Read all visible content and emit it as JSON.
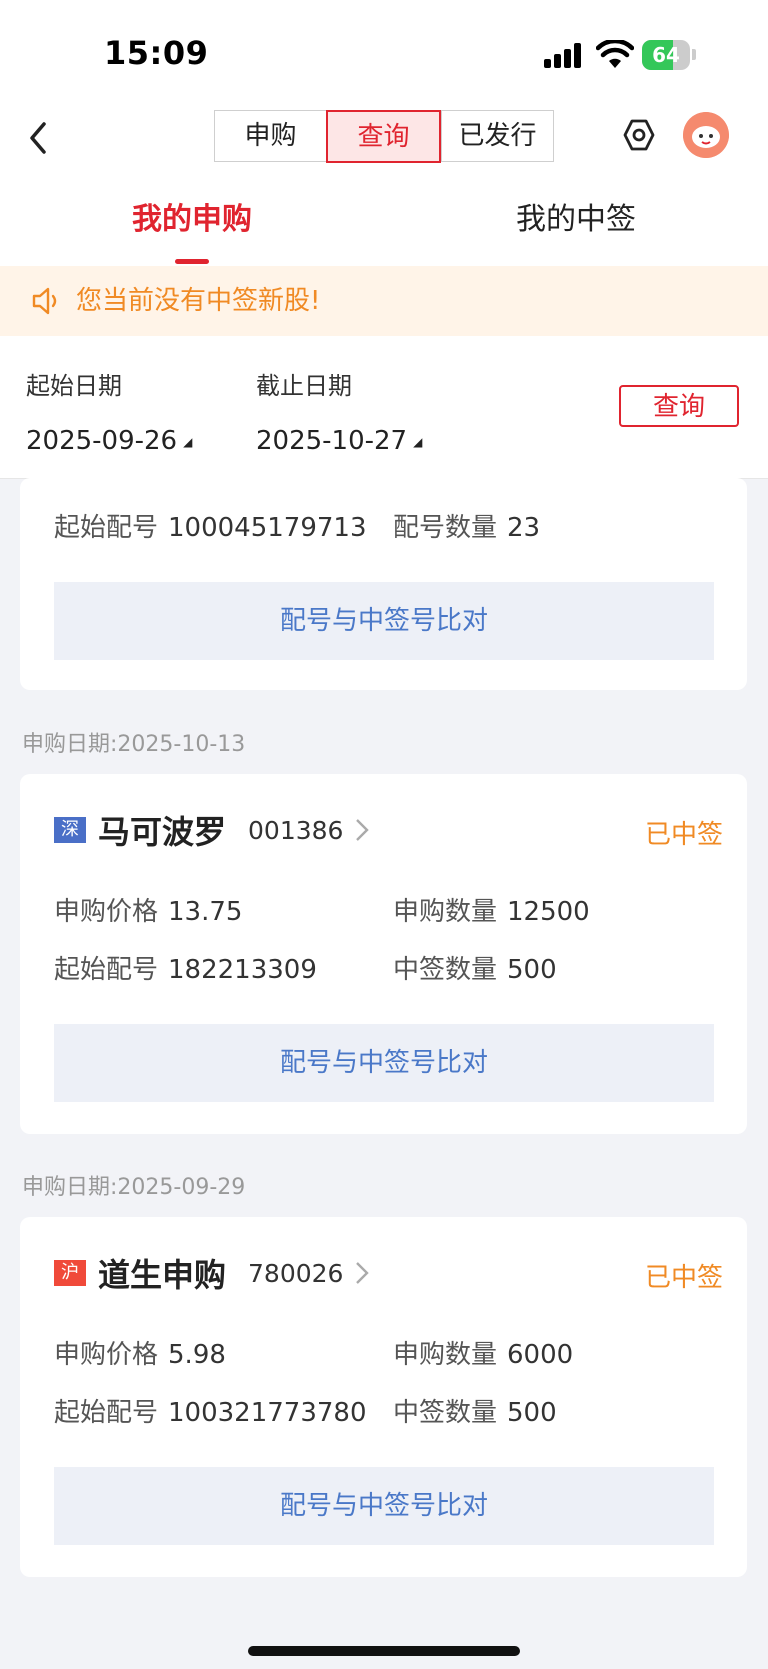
{
  "status_bar": {
    "time": "15:09",
    "battery": "64",
    "battery_level": 0.64
  },
  "nav": {
    "segments": [
      "申购",
      "查询",
      "已发行"
    ],
    "active_segment": 1,
    "tabs": [
      "我的申购",
      "我的中签"
    ],
    "active_tab": 0
  },
  "notice": {
    "text": "您当前没有中签新股!"
  },
  "filter": {
    "start_label": "起始日期",
    "start_value": "2025-09-26",
    "end_label": "截止日期",
    "end_value": "2025-10-27",
    "query_button": "查询"
  },
  "partial_card": {
    "start_no_label": "起始配号",
    "start_no": "100045179713",
    "count_label": "配号数量",
    "count": "23",
    "compare_button": "配号与中签号比对"
  },
  "records": [
    {
      "date_label": "申购日期:",
      "date": "2025-10-13",
      "market": "深",
      "market_color": "#4a6fc7",
      "name": "马可波罗",
      "code": "001386",
      "status": "已中签",
      "price_label": "申购价格",
      "price": "13.75",
      "qty_label": "申购数量",
      "qty": "12500",
      "start_no_label": "起始配号",
      "start_no": "182213309",
      "won_label": "中签数量",
      "won": "500",
      "compare_button": "配号与中签号比对"
    },
    {
      "date_label": "申购日期:",
      "date": "2025-09-29",
      "market": "沪",
      "market_color": "#f04a3a",
      "name": "道生申购",
      "code": "780026",
      "status": "已中签",
      "price_label": "申购价格",
      "price": "5.98",
      "qty_label": "申购数量",
      "qty": "6000",
      "start_no_label": "起始配号",
      "start_no": "100321773780",
      "won_label": "中签数量",
      "won": "500",
      "compare_button": "配号与中签号比对"
    }
  ],
  "colors": {
    "accent_red": "#e0242f",
    "warning_orange": "#f08a24",
    "link_blue": "#4a78c8"
  },
  "icons": [
    "signal-icon",
    "wifi-icon",
    "battery-icon",
    "back-chevron-icon",
    "settings-hex-icon",
    "avatar-icon",
    "speaker-icon",
    "chevron-right-icon"
  ]
}
